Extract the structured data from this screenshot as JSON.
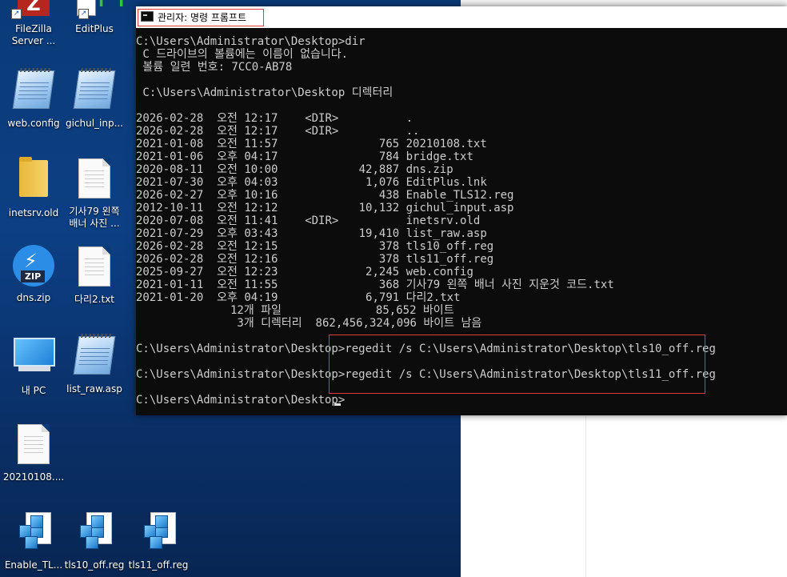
{
  "window": {
    "title": "관리자: 명령 프롬프트"
  },
  "desktop_icons": [
    {
      "name": "FileZilla Server ...",
      "type": "app-filezilla"
    },
    {
      "name": "EditPlus",
      "type": "app-editplus"
    },
    {
      "name": "web.config",
      "type": "notepad"
    },
    {
      "name": "gichul_inp...",
      "type": "notepad"
    },
    {
      "name": "inetsrv.old",
      "type": "folder"
    },
    {
      "name": "기사79 왼쪽 배너 사진 ...",
      "type": "document"
    },
    {
      "name": "dns.zip",
      "type": "zip"
    },
    {
      "name": "다리2.txt",
      "type": "document"
    },
    {
      "name": "내 PC",
      "type": "computer"
    },
    {
      "name": "list_raw.asp",
      "type": "notepad"
    },
    {
      "name": "20210108....",
      "type": "document"
    },
    {
      "name": "Enable_TL...",
      "type": "registry"
    },
    {
      "name": "tls10_off.reg",
      "type": "registry"
    },
    {
      "name": "tls11_off.reg",
      "type": "registry"
    }
  ],
  "console": {
    "lines": [
      "C:\\Users\\Administrator\\Desktop>dir",
      " C 드라이브의 볼륨에는 이름이 없습니다.",
      " 볼륨 일련 번호: 7CC0-AB78",
      "",
      " C:\\Users\\Administrator\\Desktop 디렉터리",
      "",
      "2026-02-28  오전 12:17    <DIR>          .",
      "2026-02-28  오전 12:17    <DIR>          ..",
      "2021-01-08  오전 11:57               765 20210108.txt",
      "2021-01-06  오후 04:17               784 bridge.txt",
      "2020-08-11  오전 10:00            42,887 dns.zip",
      "2021-07-30  오후 04:03             1,076 EditPlus.lnk",
      "2026-02-27  오후 10:16               438 Enable_TLS12.reg",
      "2012-10-11  오전 12:12            10,132 gichul_input.asp",
      "2020-07-08  오전 11:41    <DIR>          inetsrv.old",
      "2021-07-29  오후 03:43            19,410 list_raw.asp",
      "2026-02-28  오전 12:15               378 tls10_off.reg",
      "2026-02-28  오전 12:16               378 tls11_off.reg",
      "2025-09-27  오전 12:23             2,245 web.config",
      "2021-01-11  오전 11:55               368 기사79 왼쪽 배너 사진 지운것 코드.txt",
      "2021-01-20  오후 04:19             6,791 다리2.txt",
      "              12개 파일              85,652 바이트",
      "               3개 디렉터리  862,456,324,096 바이트 남음",
      "",
      "C:\\Users\\Administrator\\Desktop>regedit /s C:\\Users\\Administrator\\Desktop\\tls10_off.reg",
      "",
      "C:\\Users\\Administrator\\Desktop>regedit /s C:\\Users\\Administrator\\Desktop\\tls11_off.reg",
      "",
      "C:\\Users\\Administrator\\Desktop>"
    ]
  },
  "colors": {
    "highlight_border": "#e23b3b",
    "console_text": "#cccccc",
    "console_bg": "#0c0c0c"
  }
}
